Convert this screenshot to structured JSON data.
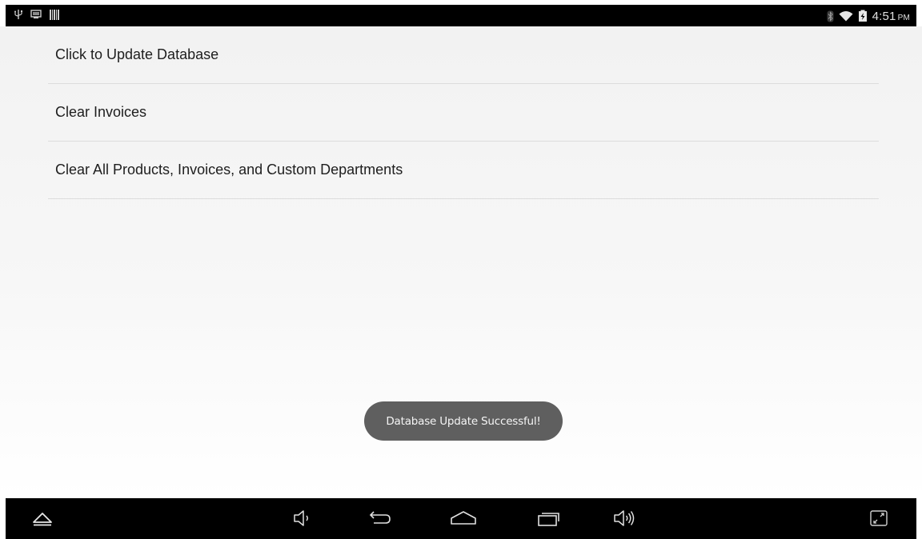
{
  "status_bar": {
    "time": "4:51",
    "ampm": "PM",
    "icons_left": [
      "usb-icon",
      "screenshot-icon",
      "barcode-icon"
    ],
    "icons_right": [
      "bluetooth-icon",
      "wifi-icon",
      "battery-icon"
    ]
  },
  "menu": {
    "items": [
      {
        "label": "Click to Update Database"
      },
      {
        "label": "Clear Invoices"
      },
      {
        "label": "Clear All Products, Invoices, and Custom Departments"
      }
    ]
  },
  "toast": {
    "message": "Database Update Successful!"
  },
  "nav_bar": {
    "buttons": [
      "hide-bar-icon",
      "volume-down-icon",
      "back-icon",
      "home-icon",
      "recent-apps-icon",
      "volume-up-icon",
      "fullscreen-icon"
    ]
  },
  "colors": {
    "status_bar_bg": "#000000",
    "nav_bar_bg": "#000000",
    "toast_bg": "#5f5f5f",
    "divider": "#dcdcdc",
    "text": "#1e1e1e"
  }
}
